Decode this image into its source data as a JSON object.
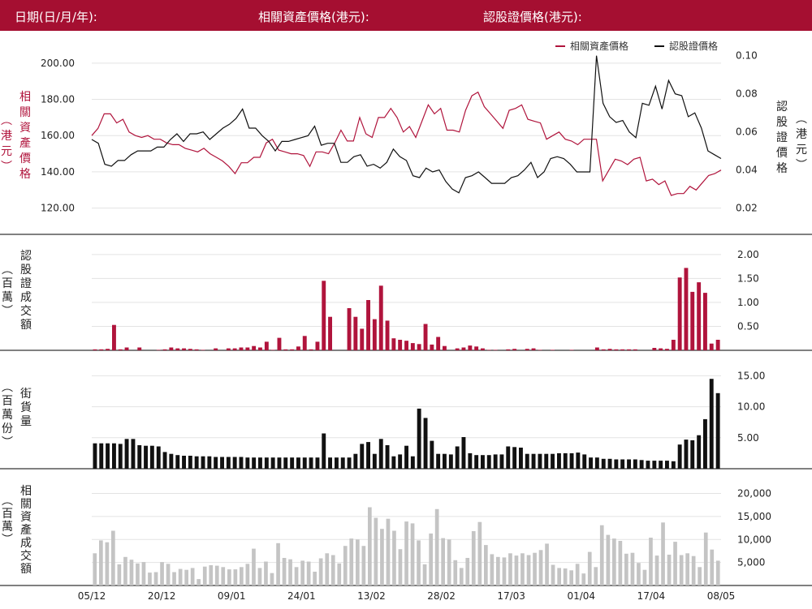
{
  "header": {
    "date_label": "日期(日/月/年):",
    "underlying_label": "相關資產價格(港元):",
    "warrant_label": "認股證價格(港元):"
  },
  "colors": {
    "brand": "#a50f31",
    "underlying": "#b0143c",
    "warrant": "#111111",
    "volume_bar": "#111111",
    "turnover_bar": "#c4c4c4"
  },
  "chart_data": [
    {
      "type": "line",
      "legend": [
        "相關資產價格",
        "認股證價格"
      ],
      "legend_position": "top-right",
      "ylabel_left": "相關資產價格(港元)",
      "ylabel_right": "認股證價格(港元)",
      "yticks_left": [
        "200.00",
        "180.00",
        "160.00",
        "140.00",
        "120.00"
      ],
      "yticks_right": [
        "0.10",
        "0.08",
        "0.06",
        "0.04",
        "0.02"
      ],
      "ylim_left": [
        114,
        208
      ],
      "ylim_right": [
        0.0143,
        0.1037
      ],
      "grid": true,
      "series": [
        {
          "name": "相關資產價格",
          "axis": "left",
          "values": [
            160,
            164,
            172,
            172,
            167,
            169,
            162,
            160,
            159,
            160,
            158,
            158,
            156,
            155,
            155,
            153,
            152,
            151,
            153,
            150,
            148,
            146,
            143,
            139,
            145,
            145,
            148,
            148,
            156,
            158,
            152,
            151,
            150,
            150,
            149,
            143,
            151,
            151,
            150,
            156,
            163,
            157,
            157,
            170,
            161,
            159,
            170,
            170,
            175,
            170,
            162,
            165,
            159,
            168,
            177,
            172,
            175,
            163,
            163,
            162,
            174,
            182,
            184,
            176,
            172,
            168,
            164,
            174,
            175,
            177,
            169,
            168,
            167,
            158,
            160,
            162,
            158,
            157,
            155,
            158,
            158,
            158,
            135,
            141,
            147,
            146,
            144,
            147,
            148,
            135,
            136,
            133,
            135,
            127,
            128,
            128,
            132,
            130,
            134,
            138,
            139,
            141
          ]
        },
        {
          "name": "認股證價格",
          "axis": "right",
          "values": [
            0.056,
            0.054,
            0.043,
            0.042,
            0.045,
            0.045,
            0.048,
            0.05,
            0.05,
            0.05,
            0.052,
            0.052,
            0.056,
            0.059,
            0.055,
            0.059,
            0.059,
            0.06,
            0.056,
            0.059,
            0.062,
            0.064,
            0.067,
            0.072,
            0.062,
            0.062,
            0.058,
            0.055,
            0.05,
            0.055,
            0.055,
            0.056,
            0.057,
            0.058,
            0.063,
            0.053,
            0.054,
            0.054,
            0.044,
            0.044,
            0.047,
            0.048,
            0.042,
            0.043,
            0.041,
            0.044,
            0.051,
            0.047,
            0.045,
            0.037,
            0.036,
            0.041,
            0.039,
            0.04,
            0.034,
            0.03,
            0.028,
            0.036,
            0.037,
            0.039,
            0.036,
            0.033,
            0.033,
            0.033,
            0.036,
            0.037,
            0.04,
            0.044,
            0.036,
            0.039,
            0.046,
            0.047,
            0.046,
            0.043,
            0.039,
            0.039,
            0.039,
            0.1,
            0.075,
            0.068,
            0.065,
            0.066,
            0.06,
            0.057,
            0.075,
            0.074,
            0.084,
            0.072,
            0.087,
            0.08,
            0.079,
            0.068,
            0.07,
            0.062,
            0.05,
            0.048,
            0.046
          ]
        }
      ],
      "x_tick_labels": [
        "05/12",
        "20/12",
        "09/01",
        "24/01",
        "13/02",
        "28/02",
        "17/03",
        "01/04",
        "17/04",
        "08/05"
      ]
    },
    {
      "type": "bar",
      "ylabel": "認股證成交額(百萬)",
      "yticks": [
        "2.00",
        "1.50",
        "1.00",
        "0.50"
      ],
      "ylim": [
        0,
        2.15
      ],
      "series": [
        {
          "name": "認股證成交額",
          "values": [
            0.02,
            0.02,
            0.03,
            0.53,
            0.02,
            0.06,
            0,
            0.06,
            0,
            0,
            0.01,
            0.02,
            0.06,
            0.04,
            0.04,
            0.03,
            0.02,
            0.01,
            0,
            0.04,
            0,
            0.04,
            0.04,
            0.06,
            0.06,
            0.09,
            0.06,
            0.18,
            0.01,
            0.26,
            0.02,
            0.02,
            0.08,
            0.3,
            0.02,
            0.18,
            1.45,
            0.7,
            0,
            0,
            0.88,
            0.7,
            0.45,
            1.05,
            0.65,
            1.35,
            0.62,
            0.25,
            0.22,
            0.2,
            0.15,
            0.13,
            0.55,
            0.12,
            0.28,
            0.09,
            0,
            0.04,
            0.06,
            0.1,
            0.08,
            0.04,
            0.01,
            0.01,
            0,
            0.02,
            0.03,
            0,
            0.03,
            0.04,
            0.01,
            0,
            0.01,
            0,
            0,
            0.01,
            0,
            0,
            0,
            0.06,
            0.02,
            0.03,
            0.02,
            0.02,
            0.02,
            0.02,
            0,
            0,
            0.05,
            0.04,
            0.03,
            0.22,
            1.52,
            1.72,
            1.22,
            1.42,
            1.2,
            0.14,
            0.22
          ]
        }
      ]
    },
    {
      "type": "bar",
      "ylabel": "街貨量(百萬份)",
      "yticks": [
        "15.00",
        "10.00",
        "5.00"
      ],
      "ylim": [
        0,
        16.1
      ],
      "series": [
        {
          "name": "街貨量",
          "values": [
            4.1,
            4.1,
            4.1,
            4.1,
            4,
            4.8,
            4.8,
            3.8,
            3.7,
            3.7,
            3.6,
            2.7,
            2.4,
            2.2,
            2.1,
            2.1,
            2,
            2,
            2,
            1.9,
            1.9,
            1.9,
            1.9,
            1.9,
            1.8,
            1.8,
            1.8,
            1.8,
            1.8,
            1.8,
            1.8,
            1.8,
            1.8,
            1.8,
            1.8,
            1.8,
            5.7,
            1.8,
            1.8,
            1.8,
            1.8,
            2.4,
            4,
            4.3,
            2.4,
            4.8,
            3.8,
            2,
            2.3,
            3.7,
            2,
            9.7,
            8.2,
            4.5,
            2.4,
            2.4,
            2.3,
            3.6,
            5.1,
            2.5,
            2.2,
            2.2,
            2.2,
            2.3,
            2.3,
            3.6,
            3.5,
            3.4,
            2.4,
            2.4,
            2.4,
            2.4,
            2.4,
            2.5,
            2.5,
            2.5,
            2.6,
            2.3,
            1.8,
            1.8,
            1.6,
            1.6,
            1.5,
            1.5,
            1.5,
            1.5,
            1.4,
            1.3,
            1.3,
            1.3,
            1.3,
            1.2,
            3.9,
            4.7,
            4.6,
            5.4,
            8,
            14.5,
            12.2
          ]
        }
      ]
    },
    {
      "type": "bar",
      "ylabel": "相關資產成交額(百萬)",
      "yticks": [
        "20,000",
        "15,000",
        "10,000",
        "5,000"
      ],
      "ylim": [
        0,
        21500
      ],
      "series": [
        {
          "name": "相關資產成交額",
          "values": [
            7000,
            9800,
            9400,
            11900,
            4600,
            6200,
            5600,
            4800,
            5100,
            2800,
            2900,
            5100,
            4700,
            2900,
            3600,
            3400,
            3800,
            1400,
            4100,
            4400,
            4300,
            4000,
            3500,
            3500,
            4000,
            4700,
            8000,
            3800,
            5200,
            2700,
            9200,
            6000,
            5700,
            4000,
            5400,
            5200,
            3000,
            5900,
            7000,
            6600,
            4800,
            8600,
            10200,
            10000,
            8600,
            17000,
            14700,
            12300,
            14500,
            11900,
            7900,
            13900,
            13500,
            9800,
            4600,
            11300,
            16600,
            10300,
            10000,
            5500,
            3800,
            6000,
            11800,
            13800,
            8800,
            6800,
            6200,
            6100,
            7000,
            6500,
            7000,
            6600,
            7100,
            7700,
            9100,
            4500,
            3800,
            3700,
            3300,
            4700,
            2600,
            7300,
            4000,
            13100,
            11000,
            10200,
            9700,
            6900,
            7100,
            4900,
            3400,
            10400,
            6500,
            13700,
            6700,
            9500,
            6600,
            7000,
            6400,
            4000,
            11500,
            7800,
            5400
          ]
        }
      ]
    }
  ]
}
